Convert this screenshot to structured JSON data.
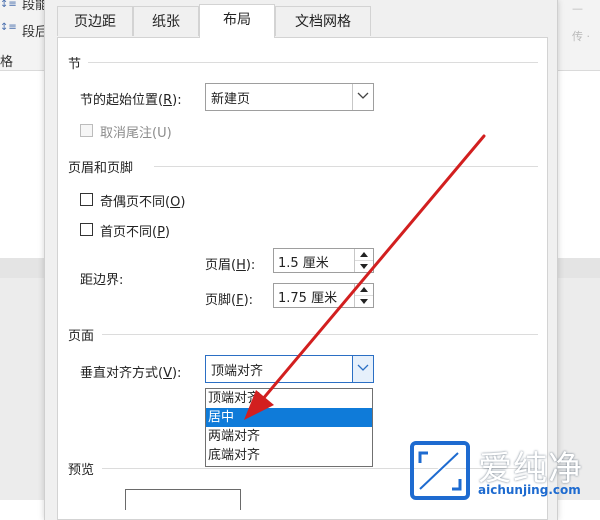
{
  "background": {
    "ribbon": {
      "item_1": "段能",
      "item_2": "段后",
      "item_3": "格",
      "right_marks": [
        "—",
        "—",
        "传 ·"
      ]
    }
  },
  "dialog": {
    "tabs": [
      "页边距",
      "纸张",
      "布局",
      "文档网格"
    ],
    "active_tab_index": 2,
    "section_section": {
      "title": "节",
      "start_label": "节的起始位置(",
      "start_key": "R",
      "start_suffix": "):",
      "start_value": "新建页",
      "suppress_endnotes_label": "取消尾注(U)",
      "suppress_endnotes_checked": false,
      "suppress_endnotes_enabled": false
    },
    "headers_footers": {
      "title": "页眉和页脚",
      "odd_even_label": "奇偶页不同(",
      "odd_even_key": "O",
      "odd_even_suffix": ")",
      "odd_even_checked": false,
      "first_page_label": "首页不同(",
      "first_page_key": "P",
      "first_page_suffix": ")",
      "first_page_checked": false,
      "from_edge_label": "距边界:",
      "header_label": "页眉(",
      "header_key": "H",
      "header_suffix": "):",
      "header_value": "1.5 厘米",
      "footer_label": "页脚(",
      "footer_key": "F",
      "footer_suffix": "):",
      "footer_value": "1.75 厘米"
    },
    "page": {
      "title": "页面",
      "vertical_align_label": "垂直对齐方式(",
      "vertical_align_key": "V",
      "vertical_align_suffix": "):",
      "vertical_align_value": "顶端对齐",
      "options": [
        "顶端对齐",
        "居中",
        "两端对齐",
        "底端对齐"
      ],
      "highlighted_option_index": 1
    },
    "preview": {
      "title": "预览"
    }
  },
  "watermark": {
    "title": "爱纯净",
    "url": "aichunjing.com"
  },
  "colors": {
    "accent": "#0f7bd9",
    "arrow": "#d21f1f",
    "dialog_bg": "#f0f0f0",
    "panel_bg": "#ffffff"
  }
}
